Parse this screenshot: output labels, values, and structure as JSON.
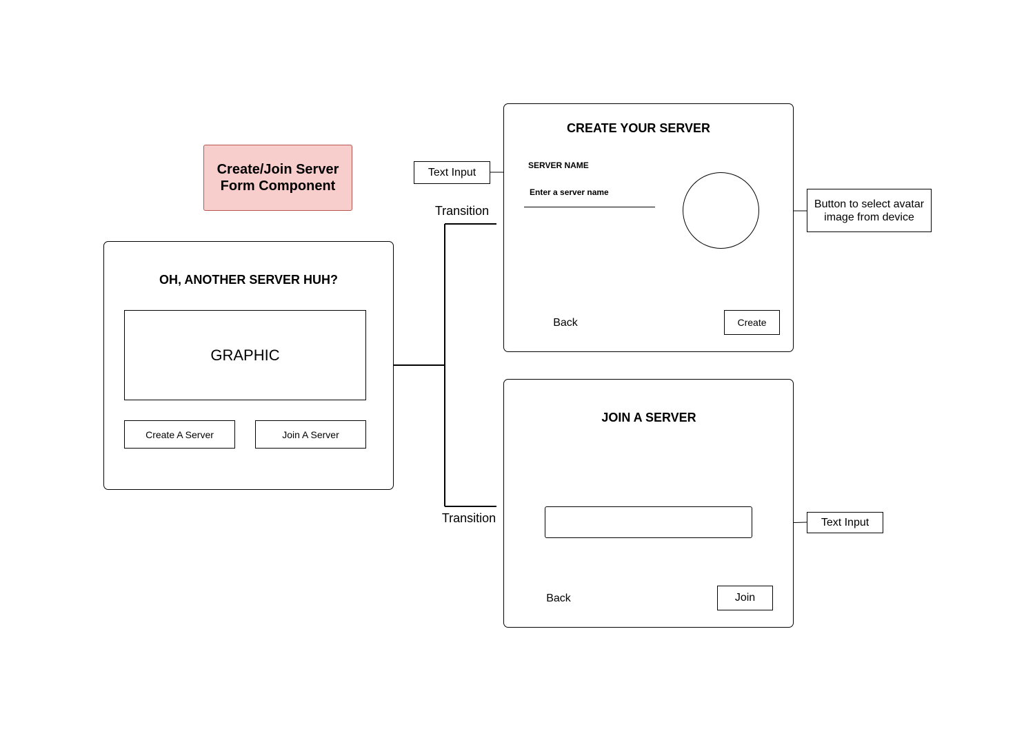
{
  "title_note": "Create/Join Server Form Component",
  "main_panel": {
    "heading": "OH, ANOTHER SERVER HUH?",
    "graphic_placeholder": "GRAPHIC",
    "create_button": "Create A Server",
    "join_button": "Join A Server"
  },
  "create_panel": {
    "heading": "CREATE YOUR SERVER",
    "server_name_label": "SERVER NAME",
    "server_name_placeholder": "Enter a server name",
    "back_label": "Back",
    "create_label": "Create"
  },
  "join_panel": {
    "heading": "JOIN A SERVER",
    "back_label": "Back",
    "join_label": "Join"
  },
  "annotations": {
    "text_input_top": "Text Input",
    "avatar_button": "Button to select avatar image from device",
    "text_input_bottom": "Text Input"
  },
  "transitions": {
    "top": "Transition",
    "bottom": "Transition"
  },
  "colors": {
    "note_fill": "#f8cecc",
    "note_border": "#b85450",
    "line": "#000000"
  }
}
